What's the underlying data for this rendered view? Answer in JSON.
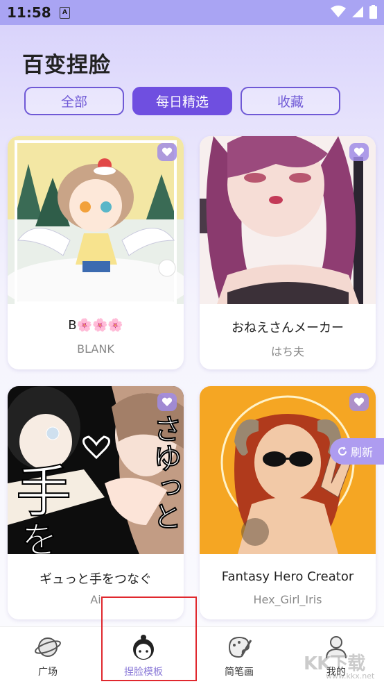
{
  "status_bar": {
    "time": "11:58",
    "notification_letter": "A"
  },
  "page": {
    "title": "百变捏脸"
  },
  "tabs": [
    {
      "label": "全部",
      "active": false
    },
    {
      "label": "每日精选",
      "active": true
    },
    {
      "label": "收藏",
      "active": false
    }
  ],
  "cards": [
    {
      "title": "B🌸🌸🌸",
      "author": "BLANK"
    },
    {
      "title": "おねえさんメーカー",
      "author": "はち夫"
    },
    {
      "title": "ギュっと手をつなぐ",
      "author": "Ai"
    },
    {
      "title": "Fantasy Hero Creator",
      "author": "Hex_Girl_Iris"
    }
  ],
  "thumb_text": {
    "kanji_te": "手",
    "kanji_wo": "を",
    "kana": "さゆっと"
  },
  "refresh_label": "刷新",
  "bottom_nav": [
    {
      "label": "广场",
      "icon": "planet-icon",
      "active": false
    },
    {
      "label": "捏脸模板",
      "icon": "face-avatar-icon",
      "active": true
    },
    {
      "label": "简笔画",
      "icon": "palette-icon",
      "active": false
    },
    {
      "label": "我的",
      "icon": "user-icon",
      "active": false
    }
  ],
  "watermark": {
    "main": "KK下载",
    "sub": "www.kkx.net"
  },
  "colors": {
    "accent": "#6f4fe0",
    "status_bar": "#a9a4f3",
    "highlight": "#e0282e"
  }
}
